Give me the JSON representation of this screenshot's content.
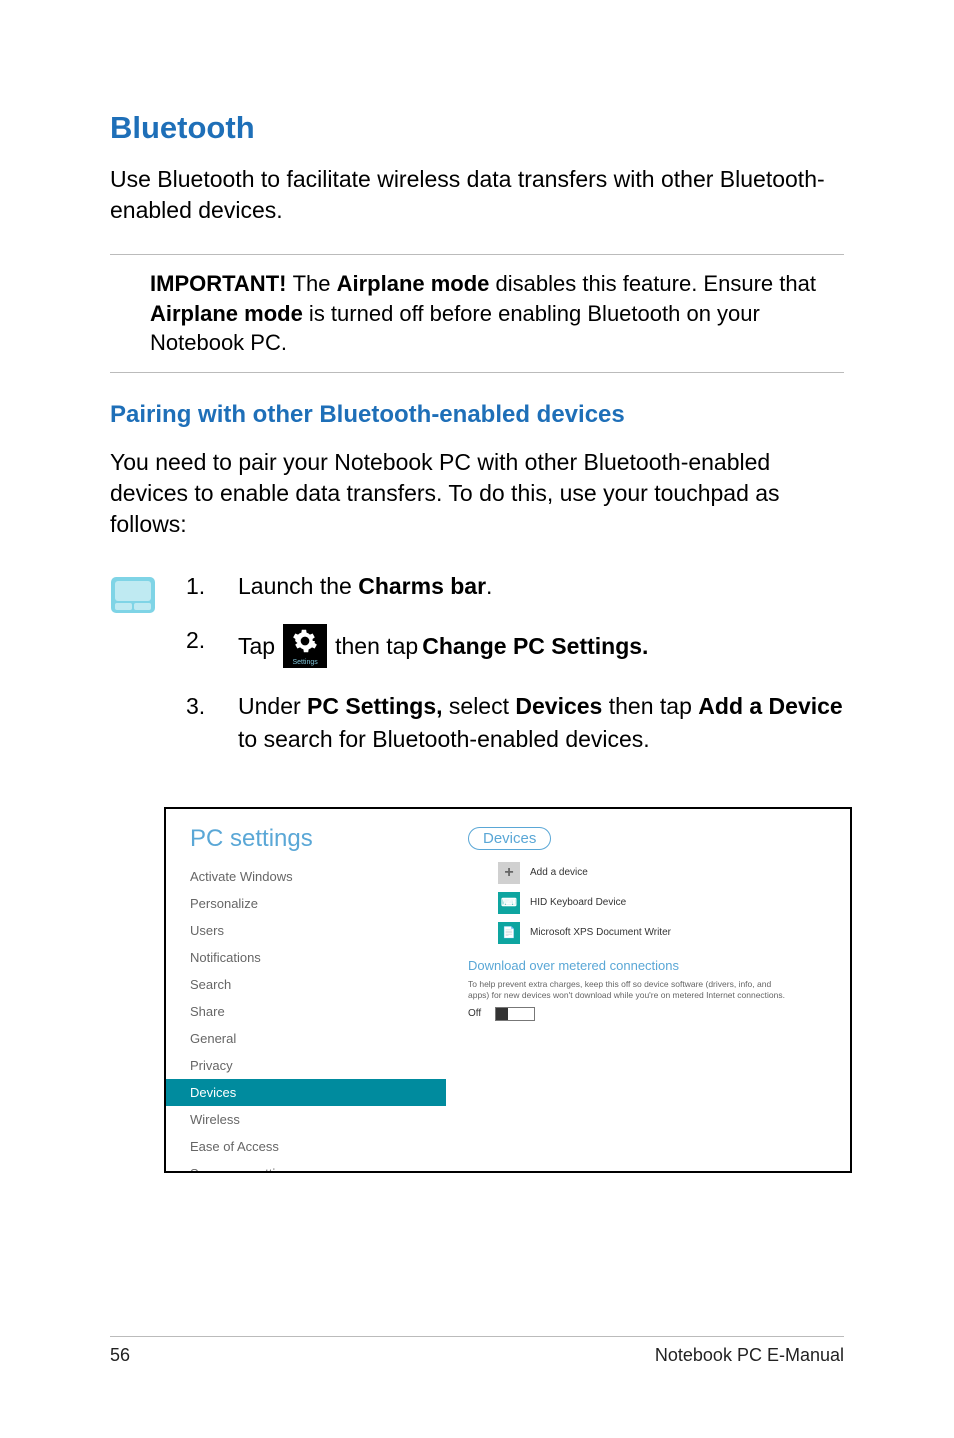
{
  "h1": "Bluetooth",
  "intro": "Use Bluetooth to facilitate wireless data transfers with other Bluetooth-enabled devices.",
  "important": {
    "prefix": "IMPORTANT! ",
    "text1": "The ",
    "bold1": "Airplane mode",
    "text2": " disables this feature. Ensure that ",
    "bold2": "Airplane mode",
    "text3": " is turned off before enabling Bluetooth on your Notebook PC."
  },
  "h2": "Pairing with other Bluetooth-enabled devices",
  "pairing_intro": "You need to pair your Notebook PC with other Bluetooth-enabled devices to enable data transfers. To do this, use your touchpad as follows:",
  "steps": {
    "s1": {
      "num": "1.",
      "t1": "Launch the ",
      "b1": "Charms bar",
      "t2": "."
    },
    "s2": {
      "num": "2.",
      "t1": "Tap ",
      "tile_label": "Settings",
      "t2": " then tap ",
      "b1": "Change PC Settings."
    },
    "s3": {
      "num": "3.",
      "t1": "Under ",
      "b1": "PC Settings,",
      "t2": " select ",
      "b2": "Devices",
      "t3": " then tap ",
      "b3": "Add a Device",
      "t4": " to search for Bluetooth-enabled devices."
    }
  },
  "screenshot": {
    "title": "PC settings",
    "items": [
      "Activate Windows",
      "Personalize",
      "Users",
      "Notifications",
      "Search",
      "Share",
      "General",
      "Privacy",
      "Devices",
      "Wireless",
      "Ease of Access",
      "Sync your settings"
    ],
    "active_index": 8,
    "right": {
      "callout": "Devices",
      "rows": [
        {
          "icon": "plus",
          "label": "Add a device"
        },
        {
          "icon": "kb",
          "label": "HID Keyboard Device"
        },
        {
          "icon": "doc",
          "label": "Microsoft XPS Document Writer"
        }
      ],
      "subhead": "Download over metered connections",
      "small": "To help prevent extra charges, keep this off so device software (drivers, info, and apps) for new devices won't download while you're on metered Internet connections.",
      "toggle_label": "Off"
    }
  },
  "footer": {
    "page": "56",
    "title": "Notebook PC E-Manual"
  }
}
